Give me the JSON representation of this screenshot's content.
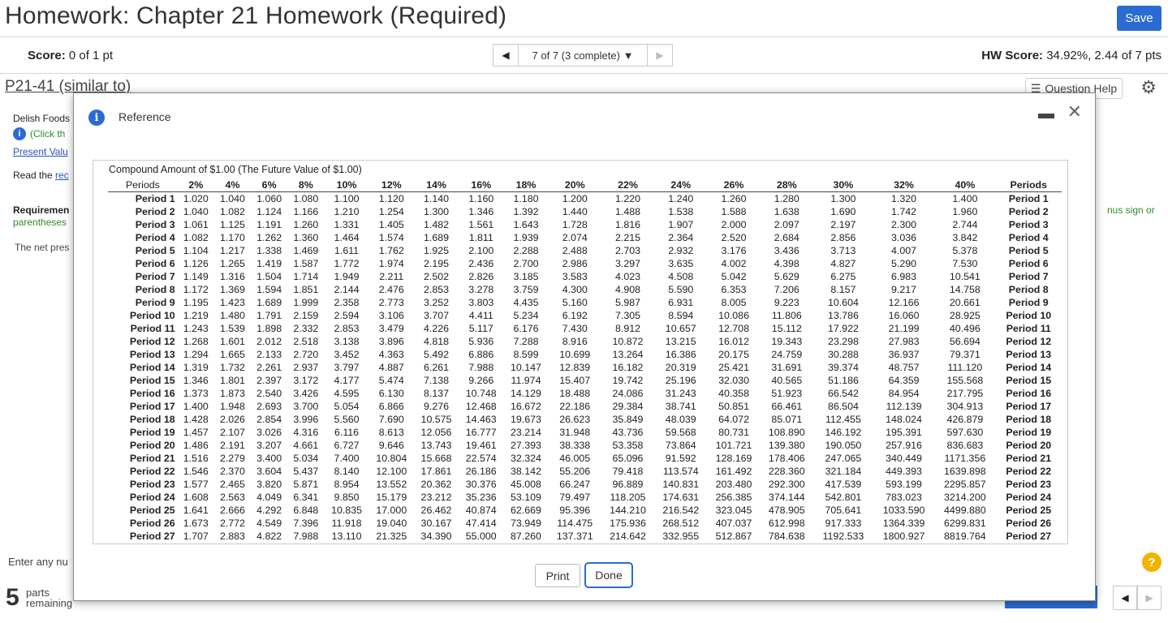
{
  "header": {
    "title": "Homework: Chapter 21 Homework (Required)",
    "save_label": "Save"
  },
  "scorebar": {
    "score_label": "Score:",
    "score_value": "0 of 1 pt",
    "nav_selector": "7 of 7 (3 complete)",
    "hw_label": "HW Score:",
    "hw_value": "34.92%, 2.44 of 7 pts"
  },
  "question": {
    "id": "P21-41 (similar to)",
    "help_label": "Question Help",
    "frag_delish": "Delish Foods",
    "frag_click": "(Click th",
    "frag_present": "Present Valu",
    "frag_read": "Read the ",
    "frag_read_link": "rec",
    "frag_requirement": "Requiremen",
    "frag_parentheses": "parentheses",
    "frag_minus": "nus sign or",
    "frag_netpres": "The net pres",
    "frag_enter": "Enter any nu",
    "parts_num": "5",
    "parts_label1": "parts",
    "parts_label2": "remaining"
  },
  "modal": {
    "title": "Reference",
    "caption": "Compound Amount of $1.00 (The Future Value of $1.00)",
    "print_label": "Print",
    "done_label": "Done"
  },
  "chart_data": {
    "type": "table",
    "title": "Compound Amount of $1.00 (The Future Value of $1.00)",
    "columns": [
      "Periods",
      "2%",
      "4%",
      "6%",
      "8%",
      "10%",
      "12%",
      "14%",
      "16%",
      "18%",
      "20%",
      "22%",
      "24%",
      "26%",
      "28%",
      "30%",
      "32%",
      "40%",
      "Periods"
    ],
    "rows": [
      {
        "period": "Period 1",
        "values": [
          "1.020",
          "1.040",
          "1.060",
          "1.080",
          "1.100",
          "1.120",
          "1.140",
          "1.160",
          "1.180",
          "1.200",
          "1.220",
          "1.240",
          "1.260",
          "1.280",
          "1.300",
          "1.320",
          "1.400"
        ]
      },
      {
        "period": "Period 2",
        "values": [
          "1.040",
          "1.082",
          "1.124",
          "1.166",
          "1.210",
          "1.254",
          "1.300",
          "1.346",
          "1.392",
          "1.440",
          "1.488",
          "1.538",
          "1.588",
          "1.638",
          "1.690",
          "1.742",
          "1.960"
        ]
      },
      {
        "period": "Period 3",
        "values": [
          "1.061",
          "1.125",
          "1.191",
          "1.260",
          "1.331",
          "1.405",
          "1.482",
          "1.561",
          "1.643",
          "1.728",
          "1.816",
          "1.907",
          "2.000",
          "2.097",
          "2.197",
          "2.300",
          "2.744"
        ]
      },
      {
        "period": "Period 4",
        "values": [
          "1.082",
          "1.170",
          "1.262",
          "1.360",
          "1.464",
          "1.574",
          "1.689",
          "1.811",
          "1.939",
          "2.074",
          "2.215",
          "2.364",
          "2.520",
          "2.684",
          "2.856",
          "3.036",
          "3.842"
        ]
      },
      {
        "period": "Period 5",
        "values": [
          "1.104",
          "1.217",
          "1.338",
          "1.469",
          "1.611",
          "1.762",
          "1.925",
          "2.100",
          "2.288",
          "2.488",
          "2.703",
          "2.932",
          "3.176",
          "3.436",
          "3.713",
          "4.007",
          "5.378"
        ]
      },
      {
        "period": "Period 6",
        "values": [
          "1.126",
          "1.265",
          "1.419",
          "1.587",
          "1.772",
          "1.974",
          "2.195",
          "2.436",
          "2.700",
          "2.986",
          "3.297",
          "3.635",
          "4.002",
          "4.398",
          "4.827",
          "5.290",
          "7.530"
        ]
      },
      {
        "period": "Period 7",
        "values": [
          "1.149",
          "1.316",
          "1.504",
          "1.714",
          "1.949",
          "2.211",
          "2.502",
          "2.826",
          "3.185",
          "3.583",
          "4.023",
          "4.508",
          "5.042",
          "5.629",
          "6.275",
          "6.983",
          "10.541"
        ]
      },
      {
        "period": "Period 8",
        "values": [
          "1.172",
          "1.369",
          "1.594",
          "1.851",
          "2.144",
          "2.476",
          "2.853",
          "3.278",
          "3.759",
          "4.300",
          "4.908",
          "5.590",
          "6.353",
          "7.206",
          "8.157",
          "9.217",
          "14.758"
        ]
      },
      {
        "period": "Period 9",
        "values": [
          "1.195",
          "1.423",
          "1.689",
          "1.999",
          "2.358",
          "2.773",
          "3.252",
          "3.803",
          "4.435",
          "5.160",
          "5.987",
          "6.931",
          "8.005",
          "9.223",
          "10.604",
          "12.166",
          "20.661"
        ]
      },
      {
        "period": "Period 10",
        "values": [
          "1.219",
          "1.480",
          "1.791",
          "2.159",
          "2.594",
          "3.106",
          "3.707",
          "4.411",
          "5.234",
          "6.192",
          "7.305",
          "8.594",
          "10.086",
          "11.806",
          "13.786",
          "16.060",
          "28.925"
        ]
      },
      {
        "period": "Period 11",
        "values": [
          "1.243",
          "1.539",
          "1.898",
          "2.332",
          "2.853",
          "3.479",
          "4.226",
          "5.117",
          "6.176",
          "7.430",
          "8.912",
          "10.657",
          "12.708",
          "15.112",
          "17.922",
          "21.199",
          "40.496"
        ]
      },
      {
        "period": "Period 12",
        "values": [
          "1.268",
          "1.601",
          "2.012",
          "2.518",
          "3.138",
          "3.896",
          "4.818",
          "5.936",
          "7.288",
          "8.916",
          "10.872",
          "13.215",
          "16.012",
          "19.343",
          "23.298",
          "27.983",
          "56.694"
        ]
      },
      {
        "period": "Period 13",
        "values": [
          "1.294",
          "1.665",
          "2.133",
          "2.720",
          "3.452",
          "4.363",
          "5.492",
          "6.886",
          "8.599",
          "10.699",
          "13.264",
          "16.386",
          "20.175",
          "24.759",
          "30.288",
          "36.937",
          "79.371"
        ]
      },
      {
        "period": "Period 14",
        "values": [
          "1.319",
          "1.732",
          "2.261",
          "2.937",
          "3.797",
          "4.887",
          "6.261",
          "7.988",
          "10.147",
          "12.839",
          "16.182",
          "20.319",
          "25.421",
          "31.691",
          "39.374",
          "48.757",
          "111.120"
        ]
      },
      {
        "period": "Period 15",
        "values": [
          "1.346",
          "1.801",
          "2.397",
          "3.172",
          "4.177",
          "5.474",
          "7.138",
          "9.266",
          "11.974",
          "15.407",
          "19.742",
          "25.196",
          "32.030",
          "40.565",
          "51.186",
          "64.359",
          "155.568"
        ]
      },
      {
        "period": "Period 16",
        "values": [
          "1.373",
          "1.873",
          "2.540",
          "3.426",
          "4.595",
          "6.130",
          "8.137",
          "10.748",
          "14.129",
          "18.488",
          "24.086",
          "31.243",
          "40.358",
          "51.923",
          "66.542",
          "84.954",
          "217.795"
        ]
      },
      {
        "period": "Period 17",
        "values": [
          "1.400",
          "1.948",
          "2.693",
          "3.700",
          "5.054",
          "6.866",
          "9.276",
          "12.468",
          "16.672",
          "22.186",
          "29.384",
          "38.741",
          "50.851",
          "66.461",
          "86.504",
          "112.139",
          "304.913"
        ]
      },
      {
        "period": "Period 18",
        "values": [
          "1.428",
          "2.026",
          "2.854",
          "3.996",
          "5.560",
          "7.690",
          "10.575",
          "14.463",
          "19.673",
          "26.623",
          "35.849",
          "48.039",
          "64.072",
          "85.071",
          "112.455",
          "148.024",
          "426.879"
        ]
      },
      {
        "period": "Period 19",
        "values": [
          "1.457",
          "2.107",
          "3.026",
          "4.316",
          "6.116",
          "8.613",
          "12.056",
          "16.777",
          "23.214",
          "31.948",
          "43.736",
          "59.568",
          "80.731",
          "108.890",
          "146.192",
          "195.391",
          "597.630"
        ]
      },
      {
        "period": "Period 20",
        "values": [
          "1.486",
          "2.191",
          "3.207",
          "4.661",
          "6.727",
          "9.646",
          "13.743",
          "19.461",
          "27.393",
          "38.338",
          "53.358",
          "73.864",
          "101.721",
          "139.380",
          "190.050",
          "257.916",
          "836.683"
        ]
      },
      {
        "period": "Period 21",
        "values": [
          "1.516",
          "2.279",
          "3.400",
          "5.034",
          "7.400",
          "10.804",
          "15.668",
          "22.574",
          "32.324",
          "46.005",
          "65.096",
          "91.592",
          "128.169",
          "178.406",
          "247.065",
          "340.449",
          "1171.356"
        ]
      },
      {
        "period": "Period 22",
        "values": [
          "1.546",
          "2.370",
          "3.604",
          "5.437",
          "8.140",
          "12.100",
          "17.861",
          "26.186",
          "38.142",
          "55.206",
          "79.418",
          "113.574",
          "161.492",
          "228.360",
          "321.184",
          "449.393",
          "1639.898"
        ]
      },
      {
        "period": "Period 23",
        "values": [
          "1.577",
          "2.465",
          "3.820",
          "5.871",
          "8.954",
          "13.552",
          "20.362",
          "30.376",
          "45.008",
          "66.247",
          "96.889",
          "140.831",
          "203.480",
          "292.300",
          "417.539",
          "593.199",
          "2295.857"
        ]
      },
      {
        "period": "Period 24",
        "values": [
          "1.608",
          "2.563",
          "4.049",
          "6.341",
          "9.850",
          "15.179",
          "23.212",
          "35.236",
          "53.109",
          "79.497",
          "118.205",
          "174.631",
          "256.385",
          "374.144",
          "542.801",
          "783.023",
          "3214.200"
        ]
      },
      {
        "period": "Period 25",
        "values": [
          "1.641",
          "2.666",
          "4.292",
          "6.848",
          "10.835",
          "17.000",
          "26.462",
          "40.874",
          "62.669",
          "95.396",
          "144.210",
          "216.542",
          "323.045",
          "478.905",
          "705.641",
          "1033.590",
          "4499.880"
        ]
      },
      {
        "period": "Period 26",
        "values": [
          "1.673",
          "2.772",
          "4.549",
          "7.396",
          "11.918",
          "19.040",
          "30.167",
          "47.414",
          "73.949",
          "114.475",
          "175.936",
          "268.512",
          "407.037",
          "612.998",
          "917.333",
          "1364.339",
          "6299.831"
        ]
      },
      {
        "period": "Period 27",
        "values": [
          "1.707",
          "2.883",
          "4.822",
          "7.988",
          "13.110",
          "21.325",
          "34.390",
          "55.000",
          "87.260",
          "137.371",
          "214.642",
          "332.955",
          "512.867",
          "784.638",
          "1192.533",
          "1800.927",
          "8819.764"
        ]
      }
    ]
  },
  "colors": {
    "accent": "#2a6bd1",
    "green_text": "#2e8b2e",
    "link": "#2a52be",
    "help": "#f0b400"
  }
}
